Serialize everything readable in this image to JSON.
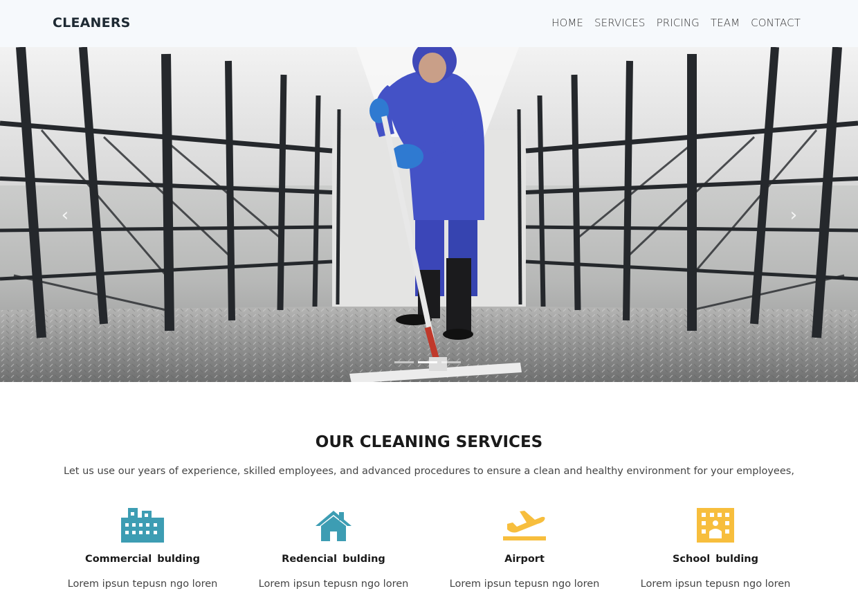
{
  "brand": "CLEANERS",
  "nav": {
    "home": "HOME",
    "services": "SERVICES",
    "pricing": "PRICING",
    "team": "TEAM",
    "contact": "CONTACT"
  },
  "carousel": {
    "prev_glyph": "‹",
    "next_glyph": "›",
    "slide_count": 3,
    "active_slide": 1
  },
  "services_section": {
    "title": "OUR CLEANING SERVICES",
    "subtitle": "Let us use our years of experience, skilled employees, and advanced procedures to ensure a clean and healthy environment for your employees,",
    "items": [
      {
        "label": "Commercial  bulding",
        "desc": "Lorem ipsun tepusn ngo loren",
        "icon": "building-icon",
        "color": "#3d9db3"
      },
      {
        "label": "Redencial  bulding",
        "desc": "Lorem ipsun tepusn ngo loren",
        "icon": "home-icon",
        "color": "#3d9db3"
      },
      {
        "label": "Airport",
        "desc": "Lorem ipsun tepusn ngo loren",
        "icon": "airplane-icon",
        "color": "#f7be3d"
      },
      {
        "label": "School  bulding",
        "desc": "Lorem ipsun tepusn ngo loren",
        "icon": "school-icon",
        "color": "#f7be3d"
      }
    ]
  },
  "colors": {
    "navbar_bg": "#f6f9fc",
    "teal_icon": "#3d9db3",
    "yellow_icon": "#f7be3d"
  }
}
